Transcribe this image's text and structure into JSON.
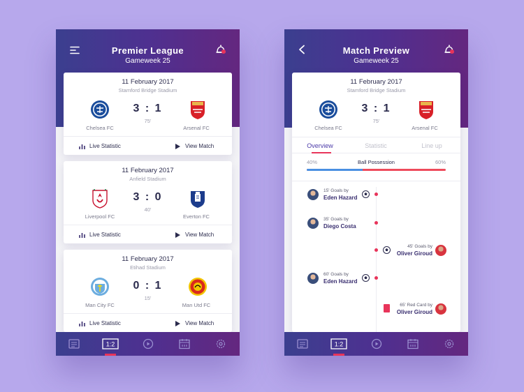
{
  "league_screen": {
    "title": "Premier League",
    "subtitle": "Gameweek 25",
    "matches": [
      {
        "date": "11 February 2017",
        "stadium": "Stamford Bridge Stadium",
        "home": "Chelsea FC",
        "away": "Arsenal FC",
        "score": "3 : 1",
        "minute": "75'",
        "live_label": "Live Statistic",
        "view_label": "View Match",
        "home_crest": "chelsea-crest",
        "away_crest": "arsenal-crest"
      },
      {
        "date": "11 February 2017",
        "stadium": "Anfield Stadium",
        "home": "Liverpool FC",
        "away": "Everton FC",
        "score": "3 : 0",
        "minute": "40'",
        "live_label": "Live Statistic",
        "view_label": "View Match",
        "home_crest": "liverpool-crest",
        "away_crest": "everton-crest"
      },
      {
        "date": "11 February 2017",
        "stadium": "Etihad Stadium",
        "home": "Man City FC",
        "away": "Man Utd FC",
        "score": "0 : 1",
        "minute": "15'",
        "live_label": "Live Statistic",
        "view_label": "View Match",
        "home_crest": "mancity-crest",
        "away_crest": "manutd-crest"
      }
    ]
  },
  "preview_screen": {
    "title": "Match Preview",
    "subtitle": "Gameweek 25",
    "match": {
      "date": "11 February 2017",
      "stadium": "Stamford Bridge Stadium",
      "home": "Chelsea FC",
      "away": "Arsenal FC",
      "score": "3 : 1",
      "minute": "75'"
    },
    "tabs": [
      "Overview",
      "Statistic",
      "Line up"
    ],
    "active_tab": "Overview",
    "possession": {
      "label": "Ball Possession",
      "home_text": "40%",
      "away_text": "60%",
      "home_value": 40
    },
    "events": [
      {
        "side": "home",
        "meta": "15' Goals by",
        "player": "Eden Hazard",
        "type": "goal"
      },
      {
        "side": "home",
        "meta": "35' Goals by",
        "player": "Diego Costa",
        "type": "goal"
      },
      {
        "side": "away",
        "meta": "45' Goals by",
        "player": "Oliver Giroud",
        "type": "goal"
      },
      {
        "side": "home",
        "meta": "60' Goals by",
        "player": "Eden Hazard",
        "type": "goal"
      },
      {
        "side": "away",
        "meta": "65' Red Card by",
        "player": "Oliver Giroud",
        "type": "red-card"
      }
    ]
  },
  "tabbar": {
    "items": [
      "news-icon",
      "scores-icon",
      "video-icon",
      "calendar-icon",
      "settings-icon"
    ],
    "scores_label": "1:2",
    "active": "scores-icon"
  },
  "colors": {
    "accent": "#e8345a",
    "header_start": "#3b3f8f",
    "header_end": "#64277f",
    "possession_home": "#4a90e2",
    "possession_away": "#ee4b5b",
    "background": "#b7a8ec"
  }
}
